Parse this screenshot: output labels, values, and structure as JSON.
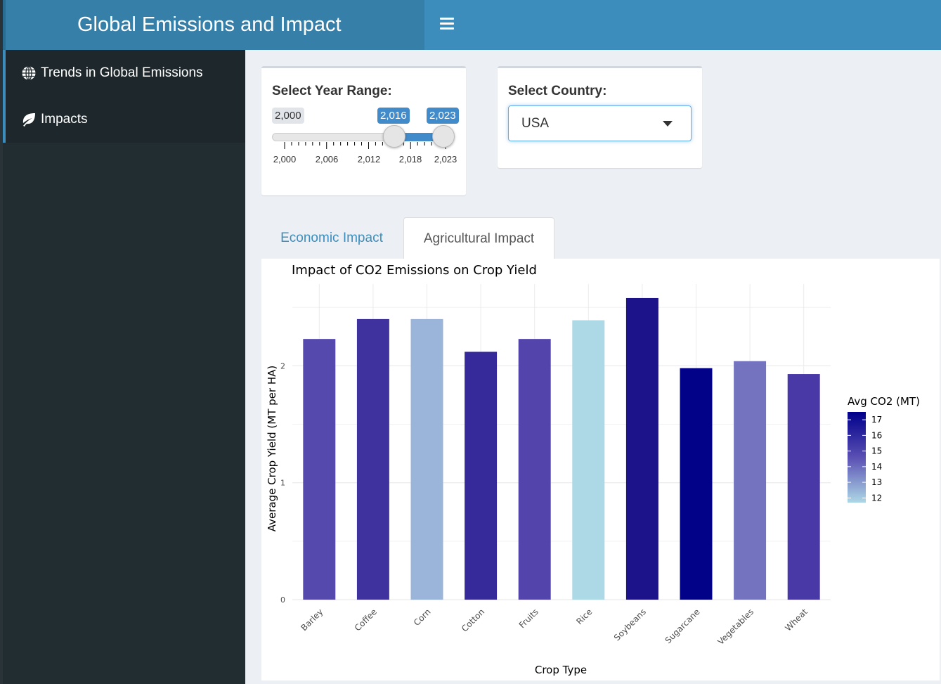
{
  "header": {
    "title": "Global Emissions and Impact"
  },
  "sidebar": {
    "items": [
      {
        "label": "Trends in Global Emissions",
        "icon": "globe-icon"
      },
      {
        "label": "Impacts",
        "icon": "leaf-icon"
      }
    ]
  },
  "year_range": {
    "label": "Select Year Range:",
    "min": 2000,
    "max": 2023,
    "min_label": "2,000",
    "max_label": "2,023",
    "from": 2016,
    "to": 2023,
    "from_label": "2,016",
    "to_label": "2,023",
    "tick_labels": [
      "2,000",
      "2,006",
      "2,012",
      "2,018",
      "2,023"
    ]
  },
  "country": {
    "label": "Select Country:",
    "value": "USA"
  },
  "tabs": [
    {
      "label": "Economic Impact",
      "active": false
    },
    {
      "label": "Agricultural Impact",
      "active": true
    }
  ],
  "chart_data": {
    "type": "bar",
    "title": "Impact of CO2 Emissions on Crop Yield",
    "xlabel": "Crop Type",
    "ylabel": "Average Crop Yield (MT per HA)",
    "categories": [
      "Barley",
      "Coffee",
      "Corn",
      "Cotton",
      "Fruits",
      "Rice",
      "Soybeans",
      "Sugarcane",
      "Vegetables",
      "Wheat"
    ],
    "values": [
      2.23,
      2.4,
      2.4,
      2.12,
      2.23,
      2.39,
      2.58,
      1.98,
      2.04,
      1.93
    ],
    "ylim": [
      0,
      2.7
    ],
    "yticks": [
      "0",
      "1",
      "2"
    ],
    "grid": true,
    "legend": {
      "title": "Avg CO2 (MT)",
      "position": "right",
      "ticks": [
        "17",
        "16",
        "15",
        "14",
        "13",
        "12"
      ],
      "min": 11.7,
      "max": 17.5,
      "color_low": "#add8e6",
      "color_high": "#00008b"
    },
    "bar_colors": [
      "#5549ae",
      "#3f329f",
      "#9bb4d9",
      "#362a9b",
      "#5244ab",
      "#add8e6",
      "#1c1289",
      "#020289",
      "#7373c0",
      "#4839a6"
    ]
  }
}
